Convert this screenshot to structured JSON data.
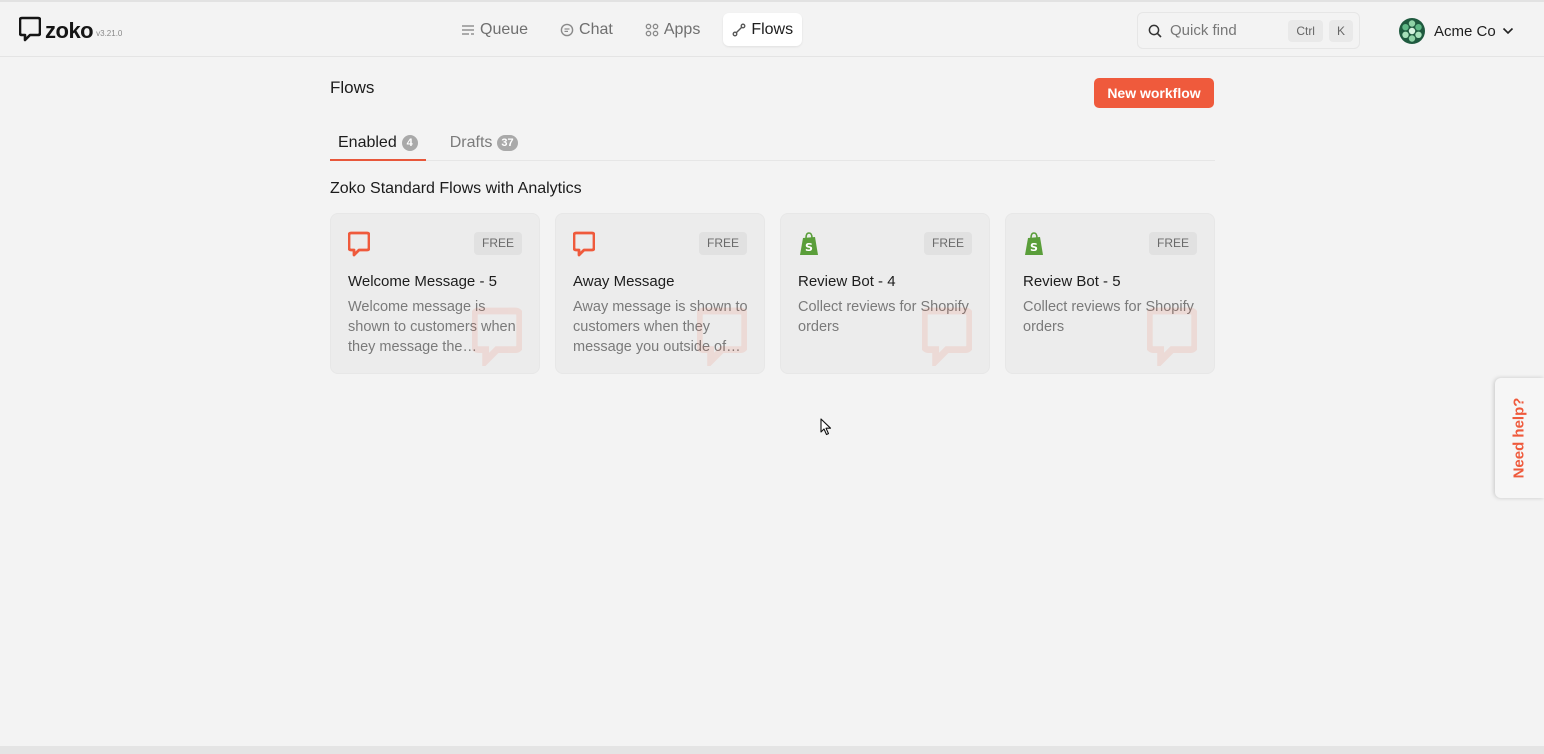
{
  "app": {
    "brand": "zoko",
    "version": "v3.21.0"
  },
  "nav": [
    {
      "label": "Queue",
      "icon": "queue-icon",
      "active": false
    },
    {
      "label": "Chat",
      "icon": "chat-icon",
      "active": false
    },
    {
      "label": "Apps",
      "icon": "apps-icon",
      "active": false
    },
    {
      "label": "Flows",
      "icon": "flows-icon",
      "active": true
    }
  ],
  "search": {
    "placeholder": "Quick find",
    "shortcut_keys": [
      "Ctrl",
      "K"
    ]
  },
  "account": {
    "name": "Acme Co"
  },
  "page": {
    "title": "Flows",
    "new_button": "New workflow"
  },
  "tabs": [
    {
      "label": "Enabled",
      "count": "4",
      "active": true
    },
    {
      "label": "Drafts",
      "count": "37",
      "active": false
    }
  ],
  "section": {
    "title": "Zoko Standard Flows with Analytics"
  },
  "cards": [
    {
      "icon": "zoko-logo-icon",
      "badge": "FREE",
      "title": "Welcome Message - 5",
      "description": "Welcome message is shown to customers when they message the business"
    },
    {
      "icon": "zoko-logo-icon",
      "badge": "FREE",
      "title": "Away Message",
      "description": "Away message is shown to customers when they message you outside of business hours"
    },
    {
      "icon": "shopify-icon",
      "badge": "FREE",
      "title": "Review Bot - 4",
      "description": "Collect reviews for Shopify orders"
    },
    {
      "icon": "shopify-icon",
      "badge": "FREE",
      "title": "Review Bot - 5",
      "description": "Collect reviews for Shopify orders"
    }
  ],
  "help": {
    "label": "Need help?"
  },
  "colors": {
    "accent": "#ef5a3c",
    "shopify_green": "#5a9e3a",
    "background": "#f3f3f3"
  }
}
